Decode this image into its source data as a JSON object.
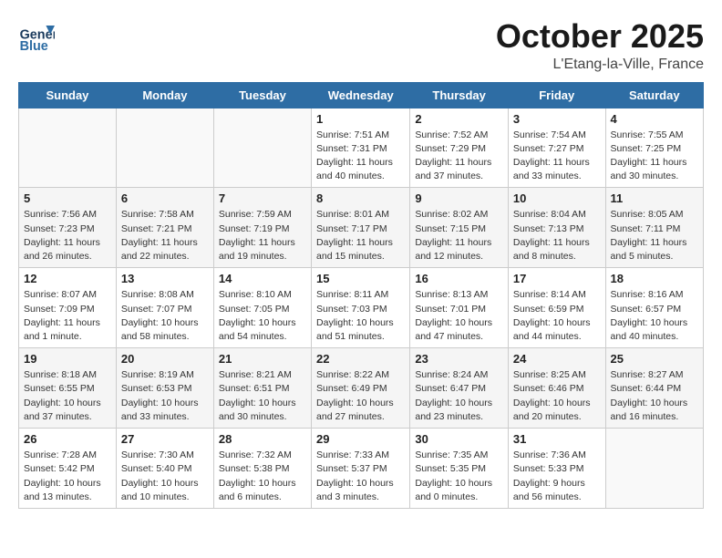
{
  "header": {
    "logo_general": "General",
    "logo_blue": "Blue",
    "month": "October 2025",
    "location": "L'Etang-la-Ville, France"
  },
  "weekdays": [
    "Sunday",
    "Monday",
    "Tuesday",
    "Wednesday",
    "Thursday",
    "Friday",
    "Saturday"
  ],
  "weeks": [
    [
      {
        "day": "",
        "info": ""
      },
      {
        "day": "",
        "info": ""
      },
      {
        "day": "",
        "info": ""
      },
      {
        "day": "1",
        "info": "Sunrise: 7:51 AM\nSunset: 7:31 PM\nDaylight: 11 hours\nand 40 minutes."
      },
      {
        "day": "2",
        "info": "Sunrise: 7:52 AM\nSunset: 7:29 PM\nDaylight: 11 hours\nand 37 minutes."
      },
      {
        "day": "3",
        "info": "Sunrise: 7:54 AM\nSunset: 7:27 PM\nDaylight: 11 hours\nand 33 minutes."
      },
      {
        "day": "4",
        "info": "Sunrise: 7:55 AM\nSunset: 7:25 PM\nDaylight: 11 hours\nand 30 minutes."
      }
    ],
    [
      {
        "day": "5",
        "info": "Sunrise: 7:56 AM\nSunset: 7:23 PM\nDaylight: 11 hours\nand 26 minutes."
      },
      {
        "day": "6",
        "info": "Sunrise: 7:58 AM\nSunset: 7:21 PM\nDaylight: 11 hours\nand 22 minutes."
      },
      {
        "day": "7",
        "info": "Sunrise: 7:59 AM\nSunset: 7:19 PM\nDaylight: 11 hours\nand 19 minutes."
      },
      {
        "day": "8",
        "info": "Sunrise: 8:01 AM\nSunset: 7:17 PM\nDaylight: 11 hours\nand 15 minutes."
      },
      {
        "day": "9",
        "info": "Sunrise: 8:02 AM\nSunset: 7:15 PM\nDaylight: 11 hours\nand 12 minutes."
      },
      {
        "day": "10",
        "info": "Sunrise: 8:04 AM\nSunset: 7:13 PM\nDaylight: 11 hours\nand 8 minutes."
      },
      {
        "day": "11",
        "info": "Sunrise: 8:05 AM\nSunset: 7:11 PM\nDaylight: 11 hours\nand 5 minutes."
      }
    ],
    [
      {
        "day": "12",
        "info": "Sunrise: 8:07 AM\nSunset: 7:09 PM\nDaylight: 11 hours\nand 1 minute."
      },
      {
        "day": "13",
        "info": "Sunrise: 8:08 AM\nSunset: 7:07 PM\nDaylight: 10 hours\nand 58 minutes."
      },
      {
        "day": "14",
        "info": "Sunrise: 8:10 AM\nSunset: 7:05 PM\nDaylight: 10 hours\nand 54 minutes."
      },
      {
        "day": "15",
        "info": "Sunrise: 8:11 AM\nSunset: 7:03 PM\nDaylight: 10 hours\nand 51 minutes."
      },
      {
        "day": "16",
        "info": "Sunrise: 8:13 AM\nSunset: 7:01 PM\nDaylight: 10 hours\nand 47 minutes."
      },
      {
        "day": "17",
        "info": "Sunrise: 8:14 AM\nSunset: 6:59 PM\nDaylight: 10 hours\nand 44 minutes."
      },
      {
        "day": "18",
        "info": "Sunrise: 8:16 AM\nSunset: 6:57 PM\nDaylight: 10 hours\nand 40 minutes."
      }
    ],
    [
      {
        "day": "19",
        "info": "Sunrise: 8:18 AM\nSunset: 6:55 PM\nDaylight: 10 hours\nand 37 minutes."
      },
      {
        "day": "20",
        "info": "Sunrise: 8:19 AM\nSunset: 6:53 PM\nDaylight: 10 hours\nand 33 minutes."
      },
      {
        "day": "21",
        "info": "Sunrise: 8:21 AM\nSunset: 6:51 PM\nDaylight: 10 hours\nand 30 minutes."
      },
      {
        "day": "22",
        "info": "Sunrise: 8:22 AM\nSunset: 6:49 PM\nDaylight: 10 hours\nand 27 minutes."
      },
      {
        "day": "23",
        "info": "Sunrise: 8:24 AM\nSunset: 6:47 PM\nDaylight: 10 hours\nand 23 minutes."
      },
      {
        "day": "24",
        "info": "Sunrise: 8:25 AM\nSunset: 6:46 PM\nDaylight: 10 hours\nand 20 minutes."
      },
      {
        "day": "25",
        "info": "Sunrise: 8:27 AM\nSunset: 6:44 PM\nDaylight: 10 hours\nand 16 minutes."
      }
    ],
    [
      {
        "day": "26",
        "info": "Sunrise: 7:28 AM\nSunset: 5:42 PM\nDaylight: 10 hours\nand 13 minutes."
      },
      {
        "day": "27",
        "info": "Sunrise: 7:30 AM\nSunset: 5:40 PM\nDaylight: 10 hours\nand 10 minutes."
      },
      {
        "day": "28",
        "info": "Sunrise: 7:32 AM\nSunset: 5:38 PM\nDaylight: 10 hours\nand 6 minutes."
      },
      {
        "day": "29",
        "info": "Sunrise: 7:33 AM\nSunset: 5:37 PM\nDaylight: 10 hours\nand 3 minutes."
      },
      {
        "day": "30",
        "info": "Sunrise: 7:35 AM\nSunset: 5:35 PM\nDaylight: 10 hours\nand 0 minutes."
      },
      {
        "day": "31",
        "info": "Sunrise: 7:36 AM\nSunset: 5:33 PM\nDaylight: 9 hours\nand 56 minutes."
      },
      {
        "day": "",
        "info": ""
      }
    ]
  ]
}
